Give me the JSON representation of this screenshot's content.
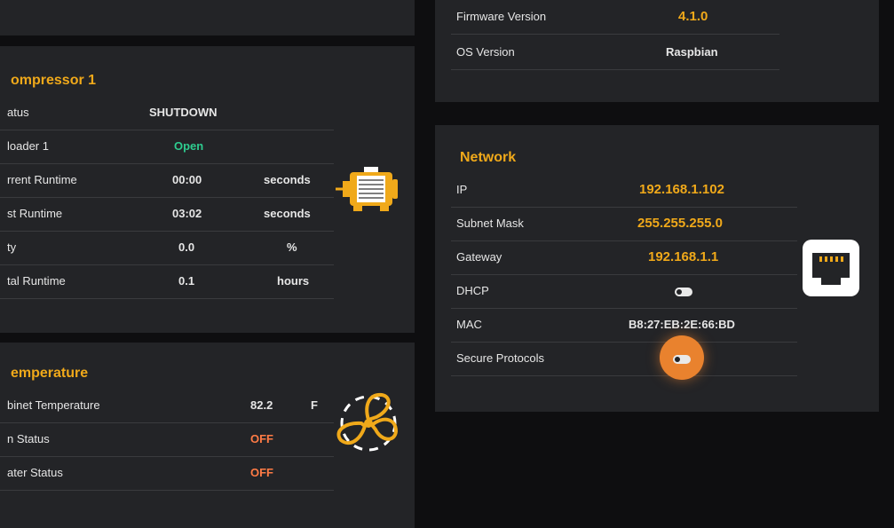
{
  "compressor": {
    "title": "ompressor 1",
    "rows": [
      {
        "label": "atus",
        "value": "SHUTDOWN",
        "unit": ""
      },
      {
        "label": "loader 1",
        "value": "Open",
        "unit": ""
      },
      {
        "label": "rrent Runtime",
        "value": "00:00",
        "unit": "seconds"
      },
      {
        "label": "st Runtime",
        "value": "03:02",
        "unit": "seconds"
      },
      {
        "label": "ty",
        "value": "0.0",
        "unit": "%"
      },
      {
        "label": "tal Runtime",
        "value": "0.1",
        "unit": "hours"
      }
    ],
    "icon": "compressor-motor-icon"
  },
  "temperature": {
    "title": "emperature",
    "rows": [
      {
        "label": "binet Temperature",
        "value": "82.2",
        "unit": "F"
      },
      {
        "label": "n Status",
        "value": "OFF",
        "unit": ""
      },
      {
        "label": "ater Status",
        "value": "OFF",
        "unit": ""
      }
    ],
    "icon": "fan-icon"
  },
  "system_info": {
    "rows": [
      {
        "label": "Firmware Version",
        "value": "4.1.0"
      },
      {
        "label": "OS Version",
        "value": "Raspbian"
      }
    ]
  },
  "network": {
    "title": "Network",
    "rows": [
      {
        "label": "IP",
        "value": "192.168.1.102"
      },
      {
        "label": "Subnet Mask",
        "value": "255.255.255.0"
      },
      {
        "label": "Gateway",
        "value": "192.168.1.1"
      },
      {
        "label": "DHCP",
        "value": "",
        "toggle": "on"
      },
      {
        "label": "MAC",
        "value": "B8:27:EB:2E:66:BD"
      },
      {
        "label": "Secure Protocols",
        "value": "",
        "toggle": "on"
      }
    ],
    "icon": "ethernet-port-icon"
  },
  "colors": {
    "accent": "#f0a91a",
    "positive": "#2ecc8f",
    "off": "#ff7b45",
    "panel": "#232427",
    "background": "#0e0e10"
  }
}
